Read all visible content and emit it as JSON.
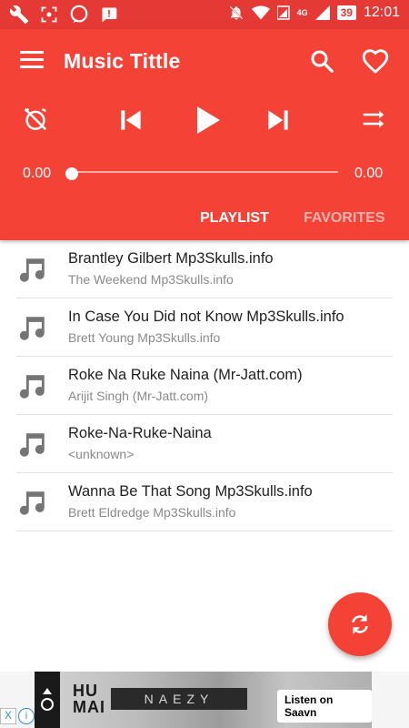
{
  "status_bar": {
    "battery": "39",
    "time": "12:01",
    "network": "4G"
  },
  "app_bar": {
    "title": "Music Tittle"
  },
  "player": {
    "elapsed": "0.00",
    "duration": "0.00",
    "progress": 0
  },
  "tabs": [
    {
      "label": "PLAYLIST",
      "active": true
    },
    {
      "label": "FAVORITES",
      "active": false
    }
  ],
  "playlist": [
    {
      "title": "Brantley Gilbert Mp3Skulls.info",
      "artist": "The Weekend Mp3Skulls.info"
    },
    {
      "title": "In Case You Did not Know Mp3Skulls.info",
      "artist": "Brett Young Mp3Skulls.info"
    },
    {
      "title": "Roke Na Ruke Naina (Mr-Jatt.com)",
      "artist": "Arijit Singh (Mr-Jatt.com)"
    },
    {
      "title": "Roke-Na-Ruke-Naina",
      "artist": "<unknown>"
    },
    {
      "title": "Wanna Be That Song Mp3Skulls.info",
      "artist": "Brett Eldredge Mp3Skulls.info"
    }
  ],
  "ad": {
    "humai": "HU\nMAI",
    "naezy": "NAEZY",
    "cta": "Listen on Saavn",
    "close": "X",
    "info": "i"
  },
  "colors": {
    "primary": "#f44336",
    "status_bar": "#e53935",
    "tab_inactive": "#ffb3ad"
  },
  "icons": {
    "menu": "hamburger-icon",
    "search": "search-icon",
    "favorite": "heart-icon",
    "timer_off": "alarm-off-icon",
    "previous": "skip-previous-icon",
    "play": "play-icon",
    "next": "skip-next-icon",
    "shuffle": "shuffle-icon",
    "track": "music-note-icon",
    "refresh": "refresh-icon"
  }
}
